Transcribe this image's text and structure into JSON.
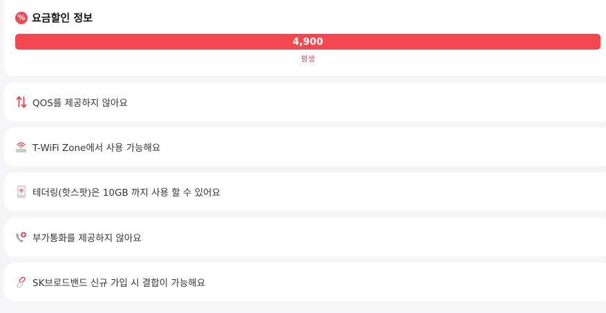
{
  "colors": {
    "accent": "#f5474f",
    "background": "#f5f5f7",
    "card": "#ffffff"
  },
  "discount": {
    "icon": "percent-icon",
    "title": "요금할인 정보",
    "price": "4,900",
    "period": "평생"
  },
  "features": [
    {
      "icon": "up-down-arrows-icon",
      "text": "QOS를 제공하지 않아요"
    },
    {
      "icon": "wifi-router-icon",
      "text": "T-WiFi Zone에서 사용 가능해요"
    },
    {
      "icon": "hotspot-phone-icon",
      "text": "테더링(핫스팟)은 10GB 까지 사용 할 수 있어요"
    },
    {
      "icon": "phone-plus-icon",
      "text": "부가통화를 제공하지 않아요"
    },
    {
      "icon": "link-icon",
      "text": "SK브로드밴드 신규 가입 시 결합이 가능해요"
    }
  ]
}
